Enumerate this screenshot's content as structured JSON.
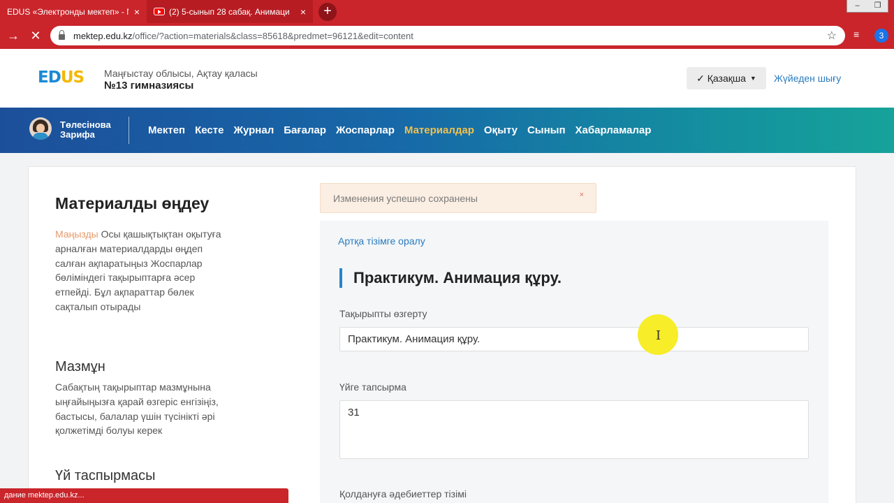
{
  "browser": {
    "tabs": [
      {
        "title": "EDUS «Электронды мектеп» - N",
        "close": "×"
      },
      {
        "title": "(2) 5-сынып 28 сабақ. Анимаци",
        "close": "×"
      }
    ],
    "new_tab": "+",
    "window_controls": [
      "–",
      "❐"
    ],
    "nav": {
      "forward": "→",
      "stop": "✕"
    },
    "url_host": "mektep.edu.kz",
    "url_path": "/office/?action=materials&class=85618&predmet=96121&edit=content",
    "star": "☆",
    "playlist_icon": "≡",
    "profile_badge": "3",
    "status_text": "дание mektep.edu.kz..."
  },
  "header": {
    "logo": {
      "e": "E",
      "d": "D",
      "u": "U",
      "s": "S"
    },
    "region": "Маңғыстау облысы, Ақтау қаласы",
    "school_name": "№13 гимназиясы",
    "language": "✓ Қазақша",
    "logout": "Жүйеден шығу"
  },
  "navbar": {
    "user_first": "Төлесінова",
    "user_last": "Зарифа",
    "items": [
      "Мектеп",
      "Кесте",
      "Журнал",
      "Бағалар",
      "Жоспарлар",
      "Материалдар",
      "Оқыту",
      "Сынып",
      "Хабарламалар"
    ],
    "active": "Материалдар"
  },
  "sidebar": {
    "title": "Материалды өңдеу",
    "note_accent": "Маңызды",
    "note_text": " Осы қашықтықтан оқытуға арналған материалдарды өңдеп салған ақпаратыңыз Жоспарлар бөліміндегі тақырыптарға әсер етпейді. Бұл ақпараттар бөлек сақталып отырады",
    "section_content": "Мазмұн",
    "content_text": "Сабақтың тақырыптар мазмұнына ыңғайыңызға қарай өзгеріс енгізіңіз, бастысы, балалар үшін түсінікті әрі қолжетімді болуы керек",
    "section_homework": "Үй таспырмасы"
  },
  "alert": {
    "message": "Изменения успешно сохранены",
    "close": "×"
  },
  "editor": {
    "back_link": "Артқа тізімге оралу",
    "lesson_title": "Практикум. Анимация құру.",
    "topic_label": "Тақырыпты өзгерту",
    "topic_value": "Практикум. Анимация құру.",
    "homework_label": "Үйге тапсырма",
    "homework_value": "31",
    "literature_label": "Қолдануға әдебиеттер тізімі"
  },
  "cursor_glyph": "I"
}
